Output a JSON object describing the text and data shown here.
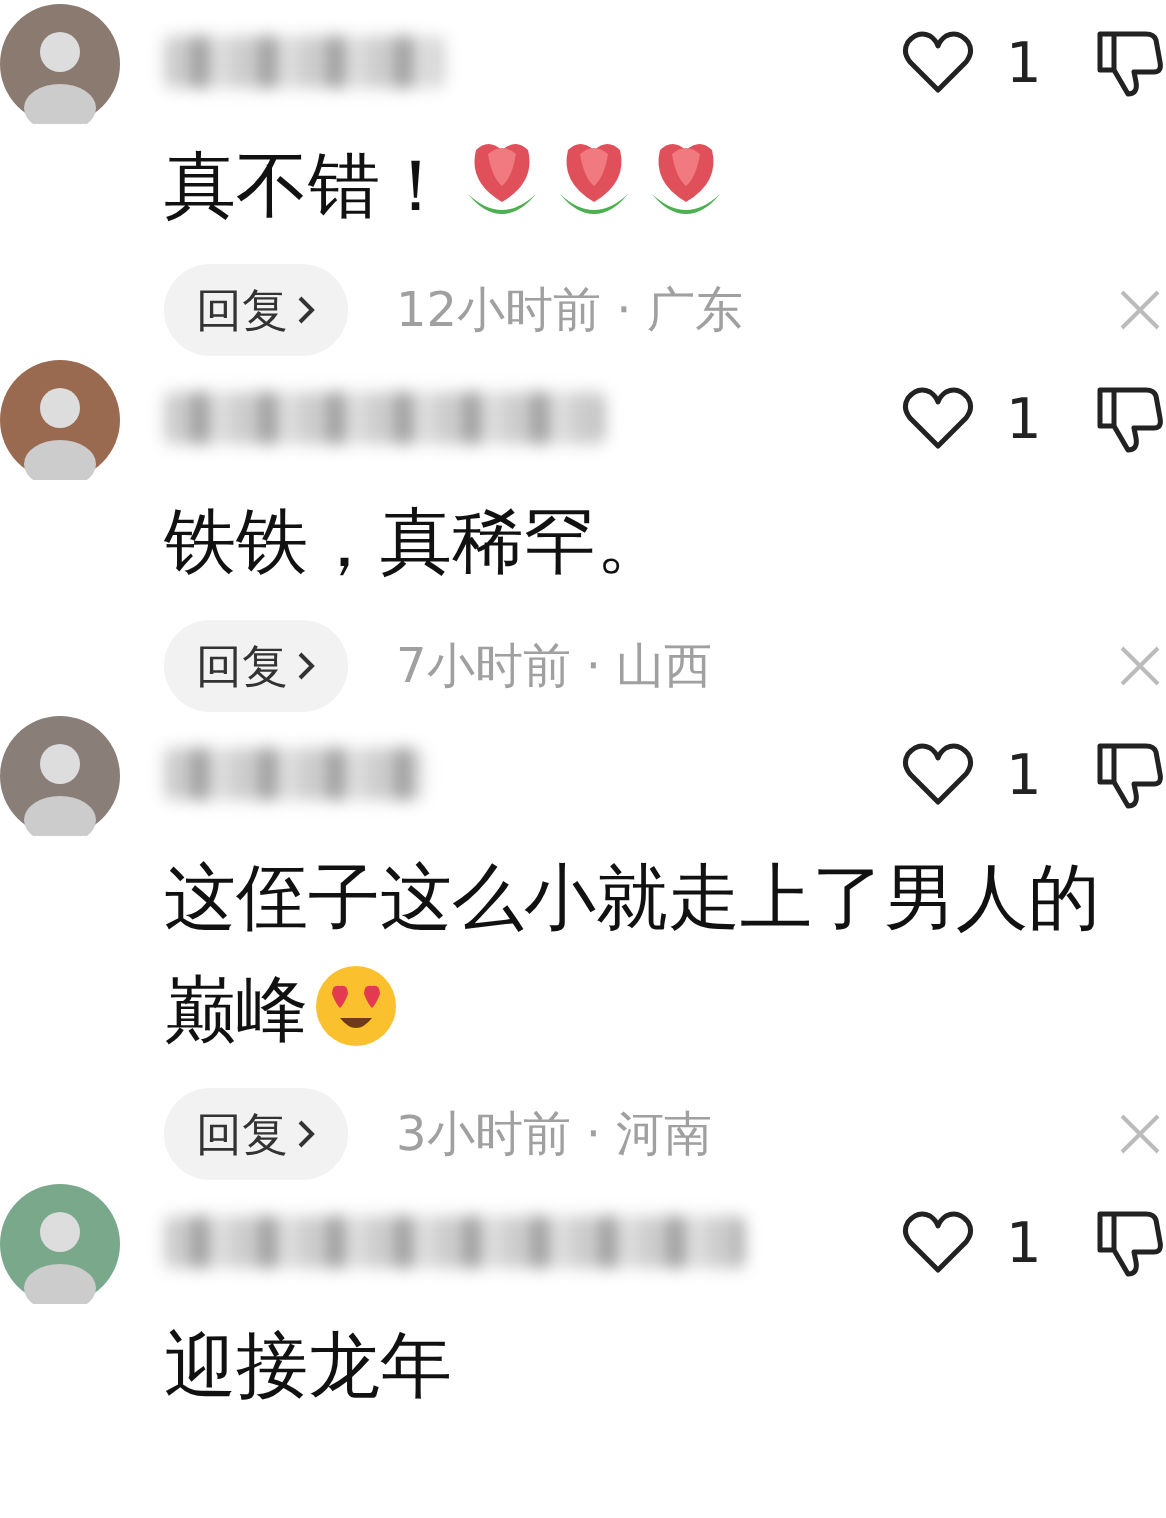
{
  "comments": [
    {
      "text": "真不错！",
      "emojis": [
        {
          "kind": "tulip"
        },
        {
          "kind": "tulip"
        },
        {
          "kind": "tulip"
        }
      ],
      "likes": "1",
      "reply": "回复",
      "meta": "12小时前 · 广东"
    },
    {
      "text": "铁铁，真稀罕。",
      "likes": "1",
      "reply": "回复",
      "meta": "7小时前 · 山西"
    },
    {
      "text": "这侄子这么小就走上了男人的巅峰",
      "emojis": [
        {
          "kind": "hearteyes"
        }
      ],
      "likes": "1",
      "reply": "回复",
      "meta": "3小时前 · 河南"
    },
    {
      "text": "迎接龙年",
      "likes": "1"
    }
  ]
}
